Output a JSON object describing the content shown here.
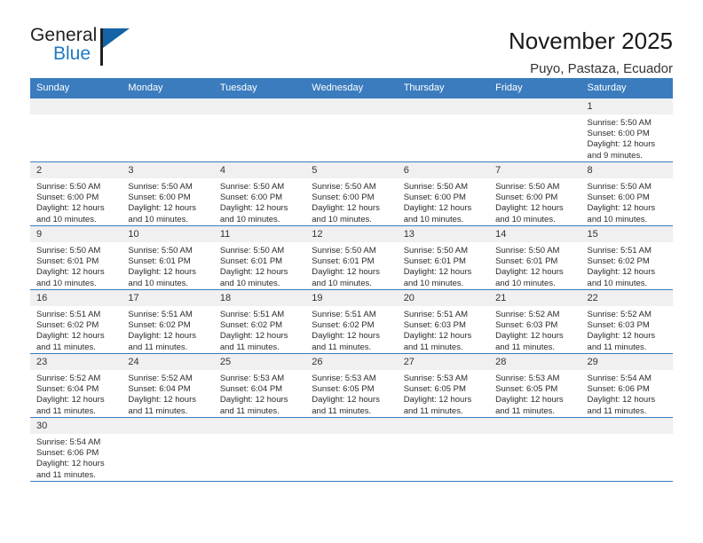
{
  "brand": {
    "name_part1": "General",
    "name_part2": "Blue",
    "accent_color": "#1d7ac4",
    "flag_color": "#1464a5"
  },
  "header": {
    "title": "November 2025",
    "subtitle": "Puyo, Pastaza, Ecuador"
  },
  "calendar": {
    "header_bg": "#3a7cbe",
    "daynum_bg": "#f0f0f0",
    "weekday_names": [
      "Sunday",
      "Monday",
      "Tuesday",
      "Wednesday",
      "Thursday",
      "Friday",
      "Saturday"
    ],
    "weeks": [
      [
        {
          "day": "",
          "sunrise": "",
          "sunset": "",
          "daylight1": "",
          "daylight2": ""
        },
        {
          "day": "",
          "sunrise": "",
          "sunset": "",
          "daylight1": "",
          "daylight2": ""
        },
        {
          "day": "",
          "sunrise": "",
          "sunset": "",
          "daylight1": "",
          "daylight2": ""
        },
        {
          "day": "",
          "sunrise": "",
          "sunset": "",
          "daylight1": "",
          "daylight2": ""
        },
        {
          "day": "",
          "sunrise": "",
          "sunset": "",
          "daylight1": "",
          "daylight2": ""
        },
        {
          "day": "",
          "sunrise": "",
          "sunset": "",
          "daylight1": "",
          "daylight2": ""
        },
        {
          "day": "1",
          "sunrise": "Sunrise: 5:50 AM",
          "sunset": "Sunset: 6:00 PM",
          "daylight1": "Daylight: 12 hours",
          "daylight2": "and 9 minutes."
        }
      ],
      [
        {
          "day": "2",
          "sunrise": "Sunrise: 5:50 AM",
          "sunset": "Sunset: 6:00 PM",
          "daylight1": "Daylight: 12 hours",
          "daylight2": "and 10 minutes."
        },
        {
          "day": "3",
          "sunrise": "Sunrise: 5:50 AM",
          "sunset": "Sunset: 6:00 PM",
          "daylight1": "Daylight: 12 hours",
          "daylight2": "and 10 minutes."
        },
        {
          "day": "4",
          "sunrise": "Sunrise: 5:50 AM",
          "sunset": "Sunset: 6:00 PM",
          "daylight1": "Daylight: 12 hours",
          "daylight2": "and 10 minutes."
        },
        {
          "day": "5",
          "sunrise": "Sunrise: 5:50 AM",
          "sunset": "Sunset: 6:00 PM",
          "daylight1": "Daylight: 12 hours",
          "daylight2": "and 10 minutes."
        },
        {
          "day": "6",
          "sunrise": "Sunrise: 5:50 AM",
          "sunset": "Sunset: 6:00 PM",
          "daylight1": "Daylight: 12 hours",
          "daylight2": "and 10 minutes."
        },
        {
          "day": "7",
          "sunrise": "Sunrise: 5:50 AM",
          "sunset": "Sunset: 6:00 PM",
          "daylight1": "Daylight: 12 hours",
          "daylight2": "and 10 minutes."
        },
        {
          "day": "8",
          "sunrise": "Sunrise: 5:50 AM",
          "sunset": "Sunset: 6:00 PM",
          "daylight1": "Daylight: 12 hours",
          "daylight2": "and 10 minutes."
        }
      ],
      [
        {
          "day": "9",
          "sunrise": "Sunrise: 5:50 AM",
          "sunset": "Sunset: 6:01 PM",
          "daylight1": "Daylight: 12 hours",
          "daylight2": "and 10 minutes."
        },
        {
          "day": "10",
          "sunrise": "Sunrise: 5:50 AM",
          "sunset": "Sunset: 6:01 PM",
          "daylight1": "Daylight: 12 hours",
          "daylight2": "and 10 minutes."
        },
        {
          "day": "11",
          "sunrise": "Sunrise: 5:50 AM",
          "sunset": "Sunset: 6:01 PM",
          "daylight1": "Daylight: 12 hours",
          "daylight2": "and 10 minutes."
        },
        {
          "day": "12",
          "sunrise": "Sunrise: 5:50 AM",
          "sunset": "Sunset: 6:01 PM",
          "daylight1": "Daylight: 12 hours",
          "daylight2": "and 10 minutes."
        },
        {
          "day": "13",
          "sunrise": "Sunrise: 5:50 AM",
          "sunset": "Sunset: 6:01 PM",
          "daylight1": "Daylight: 12 hours",
          "daylight2": "and 10 minutes."
        },
        {
          "day": "14",
          "sunrise": "Sunrise: 5:50 AM",
          "sunset": "Sunset: 6:01 PM",
          "daylight1": "Daylight: 12 hours",
          "daylight2": "and 10 minutes."
        },
        {
          "day": "15",
          "sunrise": "Sunrise: 5:51 AM",
          "sunset": "Sunset: 6:02 PM",
          "daylight1": "Daylight: 12 hours",
          "daylight2": "and 10 minutes."
        }
      ],
      [
        {
          "day": "16",
          "sunrise": "Sunrise: 5:51 AM",
          "sunset": "Sunset: 6:02 PM",
          "daylight1": "Daylight: 12 hours",
          "daylight2": "and 11 minutes."
        },
        {
          "day": "17",
          "sunrise": "Sunrise: 5:51 AM",
          "sunset": "Sunset: 6:02 PM",
          "daylight1": "Daylight: 12 hours",
          "daylight2": "and 11 minutes."
        },
        {
          "day": "18",
          "sunrise": "Sunrise: 5:51 AM",
          "sunset": "Sunset: 6:02 PM",
          "daylight1": "Daylight: 12 hours",
          "daylight2": "and 11 minutes."
        },
        {
          "day": "19",
          "sunrise": "Sunrise: 5:51 AM",
          "sunset": "Sunset: 6:02 PM",
          "daylight1": "Daylight: 12 hours",
          "daylight2": "and 11 minutes."
        },
        {
          "day": "20",
          "sunrise": "Sunrise: 5:51 AM",
          "sunset": "Sunset: 6:03 PM",
          "daylight1": "Daylight: 12 hours",
          "daylight2": "and 11 minutes."
        },
        {
          "day": "21",
          "sunrise": "Sunrise: 5:52 AM",
          "sunset": "Sunset: 6:03 PM",
          "daylight1": "Daylight: 12 hours",
          "daylight2": "and 11 minutes."
        },
        {
          "day": "22",
          "sunrise": "Sunrise: 5:52 AM",
          "sunset": "Sunset: 6:03 PM",
          "daylight1": "Daylight: 12 hours",
          "daylight2": "and 11 minutes."
        }
      ],
      [
        {
          "day": "23",
          "sunrise": "Sunrise: 5:52 AM",
          "sunset": "Sunset: 6:04 PM",
          "daylight1": "Daylight: 12 hours",
          "daylight2": "and 11 minutes."
        },
        {
          "day": "24",
          "sunrise": "Sunrise: 5:52 AM",
          "sunset": "Sunset: 6:04 PM",
          "daylight1": "Daylight: 12 hours",
          "daylight2": "and 11 minutes."
        },
        {
          "day": "25",
          "sunrise": "Sunrise: 5:53 AM",
          "sunset": "Sunset: 6:04 PM",
          "daylight1": "Daylight: 12 hours",
          "daylight2": "and 11 minutes."
        },
        {
          "day": "26",
          "sunrise": "Sunrise: 5:53 AM",
          "sunset": "Sunset: 6:05 PM",
          "daylight1": "Daylight: 12 hours",
          "daylight2": "and 11 minutes."
        },
        {
          "day": "27",
          "sunrise": "Sunrise: 5:53 AM",
          "sunset": "Sunset: 6:05 PM",
          "daylight1": "Daylight: 12 hours",
          "daylight2": "and 11 minutes."
        },
        {
          "day": "28",
          "sunrise": "Sunrise: 5:53 AM",
          "sunset": "Sunset: 6:05 PM",
          "daylight1": "Daylight: 12 hours",
          "daylight2": "and 11 minutes."
        },
        {
          "day": "29",
          "sunrise": "Sunrise: 5:54 AM",
          "sunset": "Sunset: 6:06 PM",
          "daylight1": "Daylight: 12 hours",
          "daylight2": "and 11 minutes."
        }
      ],
      [
        {
          "day": "30",
          "sunrise": "Sunrise: 5:54 AM",
          "sunset": "Sunset: 6:06 PM",
          "daylight1": "Daylight: 12 hours",
          "daylight2": "and 11 minutes."
        },
        {
          "day": "",
          "sunrise": "",
          "sunset": "",
          "daylight1": "",
          "daylight2": ""
        },
        {
          "day": "",
          "sunrise": "",
          "sunset": "",
          "daylight1": "",
          "daylight2": ""
        },
        {
          "day": "",
          "sunrise": "",
          "sunset": "",
          "daylight1": "",
          "daylight2": ""
        },
        {
          "day": "",
          "sunrise": "",
          "sunset": "",
          "daylight1": "",
          "daylight2": ""
        },
        {
          "day": "",
          "sunrise": "",
          "sunset": "",
          "daylight1": "",
          "daylight2": ""
        },
        {
          "day": "",
          "sunrise": "",
          "sunset": "",
          "daylight1": "",
          "daylight2": ""
        }
      ]
    ]
  }
}
